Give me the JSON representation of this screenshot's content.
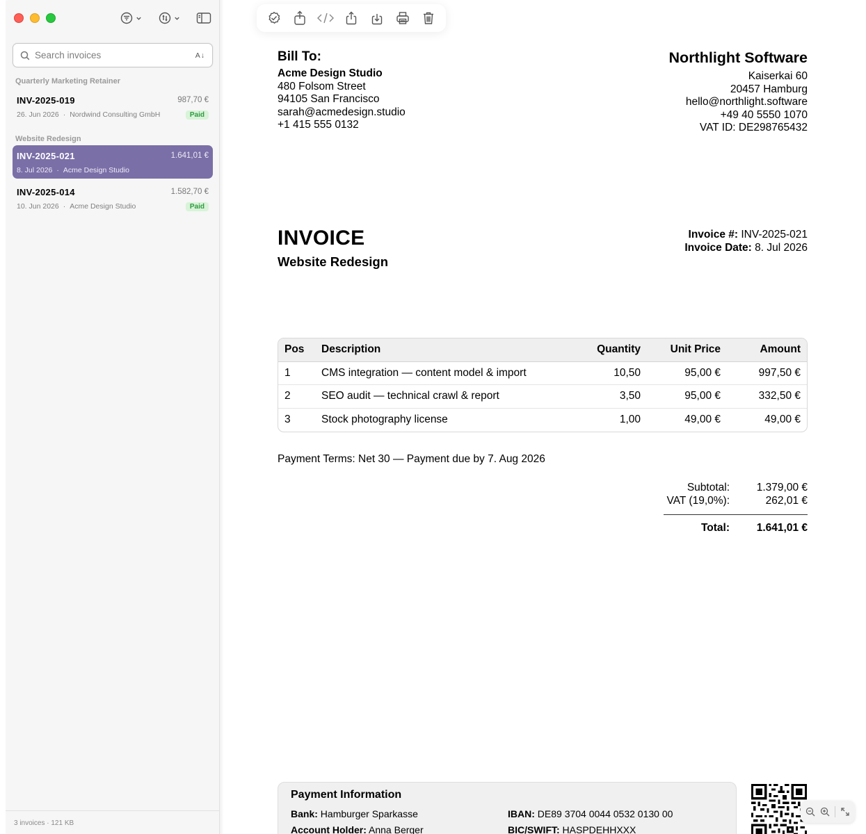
{
  "sidebar": {
    "search_placeholder": "Search invoices",
    "sort_label": "A↓",
    "groups": [
      {
        "title": "Quarterly Marketing Retainer",
        "items": [
          {
            "number": "INV-2025-019",
            "amount": "987,70 €",
            "date": "26. Jun 2026",
            "client": "Nordwind Consulting GmbH",
            "status": "Paid",
            "selected": false
          }
        ]
      },
      {
        "title": "Website Redesign",
        "items": [
          {
            "number": "INV-2025-021",
            "amount": "1.641,01 €",
            "date": "8. Jul 2026",
            "client": "Acme Design Studio",
            "status": "",
            "selected": true
          },
          {
            "number": "INV-2025-014",
            "amount": "1.582,70 €",
            "date": "10. Jun 2026",
            "client": "Acme Design Studio",
            "status": "Paid",
            "selected": false
          }
        ]
      }
    ],
    "footer": "3 invoices · 121 KB",
    "selected_color": "#7b6fa7"
  },
  "toolbar": {
    "icons": [
      "verify-icon",
      "share-out-icon",
      "code-icon",
      "share-icon",
      "download-icon",
      "print-icon",
      "trash-icon"
    ]
  },
  "invoice": {
    "bill_to_title": "Bill To:",
    "bill_to": {
      "name": "Acme Design Studio",
      "street": "480 Folsom Street",
      "city": "94105 San Francisco",
      "email": "sarah@acmedesign.studio",
      "phone": "+1 415 555 0132"
    },
    "company": {
      "name": "Northlight Software",
      "street": "Kaiserkai 60",
      "city": "20457 Hamburg",
      "email": "hello@northlight.software",
      "phone": "+49 40 5550 1070",
      "vat": "VAT ID: DE298765432"
    },
    "title": "INVOICE",
    "subtitle": "Website Redesign",
    "number_label": "Invoice #:",
    "number": "INV-2025-021",
    "date_label": "Invoice Date:",
    "date": "8. Jul 2026",
    "table": {
      "headers": [
        "Pos",
        "Description",
        "Quantity",
        "Unit Price",
        "Amount"
      ],
      "rows": [
        [
          "1",
          "CMS integration — content model & import",
          "10,50",
          "95,00 €",
          "997,50 €"
        ],
        [
          "2",
          "SEO audit — technical crawl & report",
          "3,50",
          "95,00 €",
          "332,50 €"
        ],
        [
          "3",
          "Stock photography license",
          "1,00",
          "49,00 €",
          "49,00 €"
        ]
      ]
    },
    "payment_terms": "Payment Terms: Net 30 — Payment due by 7. Aug 2026",
    "subtotal_label": "Subtotal:",
    "subtotal": "1.379,00 €",
    "vat_label": "VAT (19,0%):",
    "vat": "262,01 €",
    "total_label": "Total:",
    "total": "1.641,01 €",
    "payment_info": {
      "title": "Payment Information",
      "bank_label": "Bank:",
      "bank": "Hamburger Sparkasse",
      "iban_label": "IBAN:",
      "iban": "DE89 3704 0044 0532 0130 00",
      "holder_label": "Account Holder:",
      "holder": "Anna Berger",
      "bic_label": "BIC/SWIFT:",
      "bic": "HASPDEHHXXX"
    }
  }
}
